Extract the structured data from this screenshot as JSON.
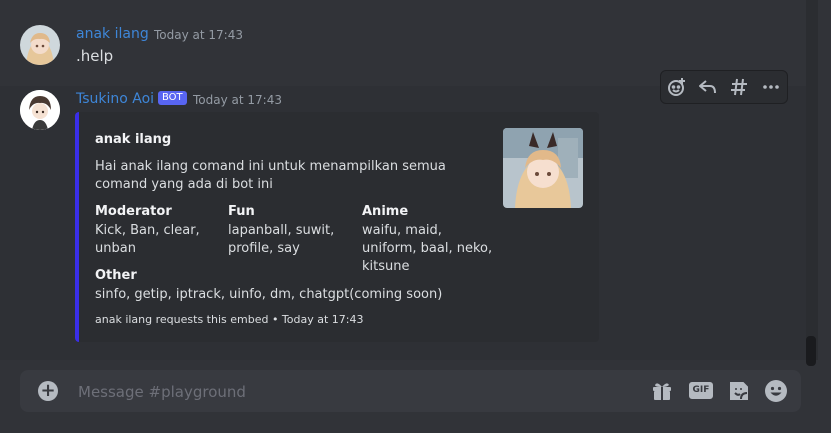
{
  "messages": [
    {
      "username": "anak ilang",
      "timestamp": "Today at 17:43",
      "text": ".help"
    },
    {
      "username": "Tsukino Aoi",
      "bot_badge": "BOT",
      "timestamp": "Today at 17:43",
      "embed": {
        "accent_color": "#3a2ee8",
        "author": "anak ilang",
        "description": "Hai anak ilang comand ini untuk menampilkan semua comand yang ada di bot ini",
        "fields": [
          {
            "name": "Moderator",
            "value": "Kick, Ban, clear, unban"
          },
          {
            "name": "Fun",
            "value": "lapanball, suwit, profile, say"
          },
          {
            "name": "Anime",
            "value": "waifu, maid, uniform, baal, neko, kitsune"
          },
          {
            "name": "Other",
            "value": "sinfo, getip, iptrack, uinfo, dm, chatgpt(coming soon)"
          }
        ],
        "footer": "anak ilang requests this embed • Today at 17:43"
      }
    }
  ],
  "toolbar": {
    "icons": [
      "add-reaction-icon",
      "reply-icon",
      "create-thread-icon",
      "more-icon"
    ]
  },
  "composer": {
    "placeholder": "Message #playground",
    "gif_label": "GIF",
    "icons": [
      "add-attachment-icon",
      "gift-icon",
      "gif-icon",
      "sticker-icon",
      "emoji-icon"
    ]
  }
}
